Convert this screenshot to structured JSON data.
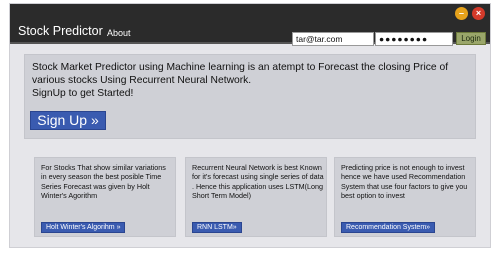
{
  "app": {
    "title": "Stock Predictor",
    "nav": {
      "about": "About"
    }
  },
  "login": {
    "email_value": "tar@tar.com",
    "password_value": "●●●●●●●●",
    "login_label": "Login"
  },
  "window_controls": {
    "minimize": "–",
    "close": "×"
  },
  "hero": {
    "line1": "Stock Market Predictor using Machine learning is an atempt to Forecast the closing Price of various stocks Using Recurrent Neural Network.",
    "line2": "SignUp to get Started!",
    "signup_label": "Sign Up »"
  },
  "cards": [
    {
      "text": "For Stocks That show similar variations in every season the best posible Time Series Forecast  was given by Holt Winter's Agorithm",
      "button": "Holt Winter's Algorihm »"
    },
    {
      "text": "Recurrent Neural Network is best Known for it's forecast using single series of data . Hence this application uses LSTM(Long Short Term Model)",
      "button": "RNN LSTM»"
    },
    {
      "text": "Predicting price is not enough to invest hence we have used Recommendation System that use four factors to give you best option to invest",
      "button": "Recommendation System»"
    }
  ],
  "colors": {
    "topbar": "#2b2b2b",
    "panel": "#cfd0d6",
    "primary_button": "#3a5bb0",
    "login_button": "#9aa66a"
  }
}
